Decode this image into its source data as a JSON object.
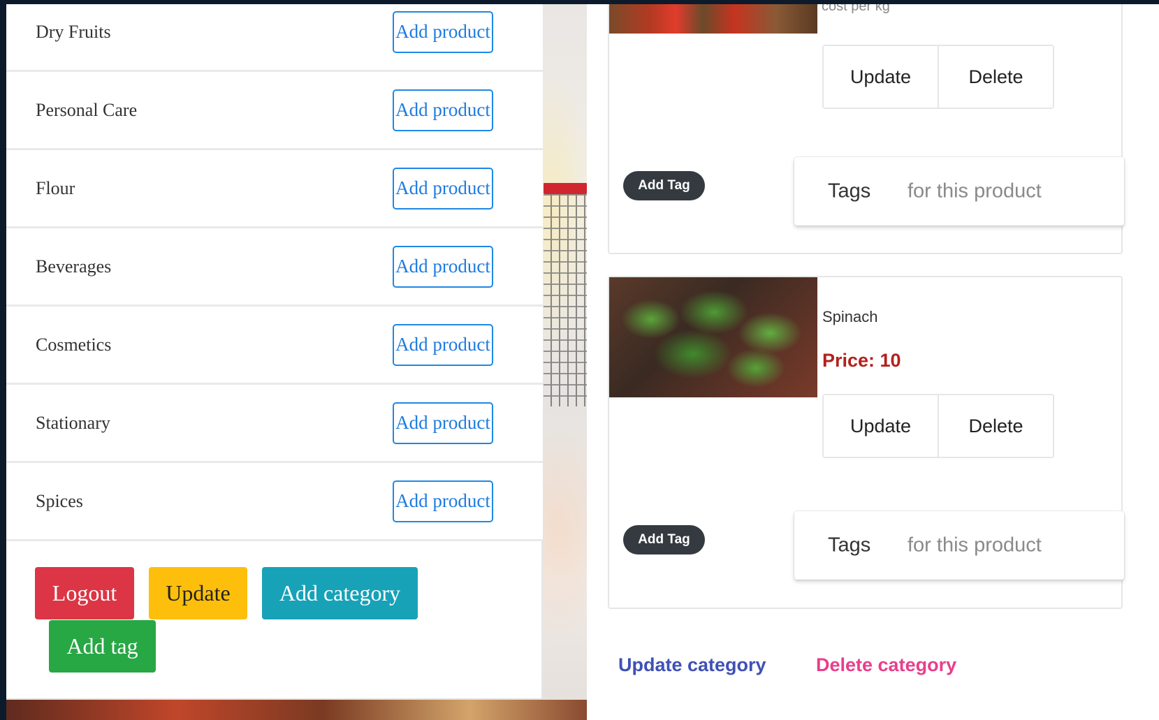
{
  "categories": [
    {
      "name": "Dry Fruits",
      "action": "Add product"
    },
    {
      "name": "Personal Care",
      "action": "Add product"
    },
    {
      "name": "Flour",
      "action": "Add product"
    },
    {
      "name": "Beverages",
      "action": "Add product"
    },
    {
      "name": "Cosmetics",
      "action": "Add product"
    },
    {
      "name": "Stationary",
      "action": "Add product"
    },
    {
      "name": "Spices",
      "action": "Add product"
    }
  ],
  "actions": {
    "logout": "Logout",
    "update": "Update",
    "add_category": "Add category",
    "add_tag": "Add tag"
  },
  "products": [
    {
      "name": "",
      "cost_label": "cost per kg",
      "update": "Update",
      "delete": "Delete",
      "add_tag": "Add Tag",
      "tags_label": "Tags",
      "tags_placeholder": "for this product"
    },
    {
      "name": "Spinach",
      "price": "Price: 10",
      "update": "Update",
      "delete": "Delete",
      "add_tag": "Add Tag",
      "tags_label": "Tags",
      "tags_placeholder": "for this product"
    }
  ],
  "category_actions": {
    "update": "Update category",
    "delete": "Delete category"
  },
  "colors": {
    "logout": "#dc3545",
    "update": "#fdbf0b",
    "add_category": "#17a2b8",
    "add_tag": "#28a745",
    "price": "#b3201d",
    "update_category": "#3f51b5",
    "delete_category": "#e83e8c"
  }
}
